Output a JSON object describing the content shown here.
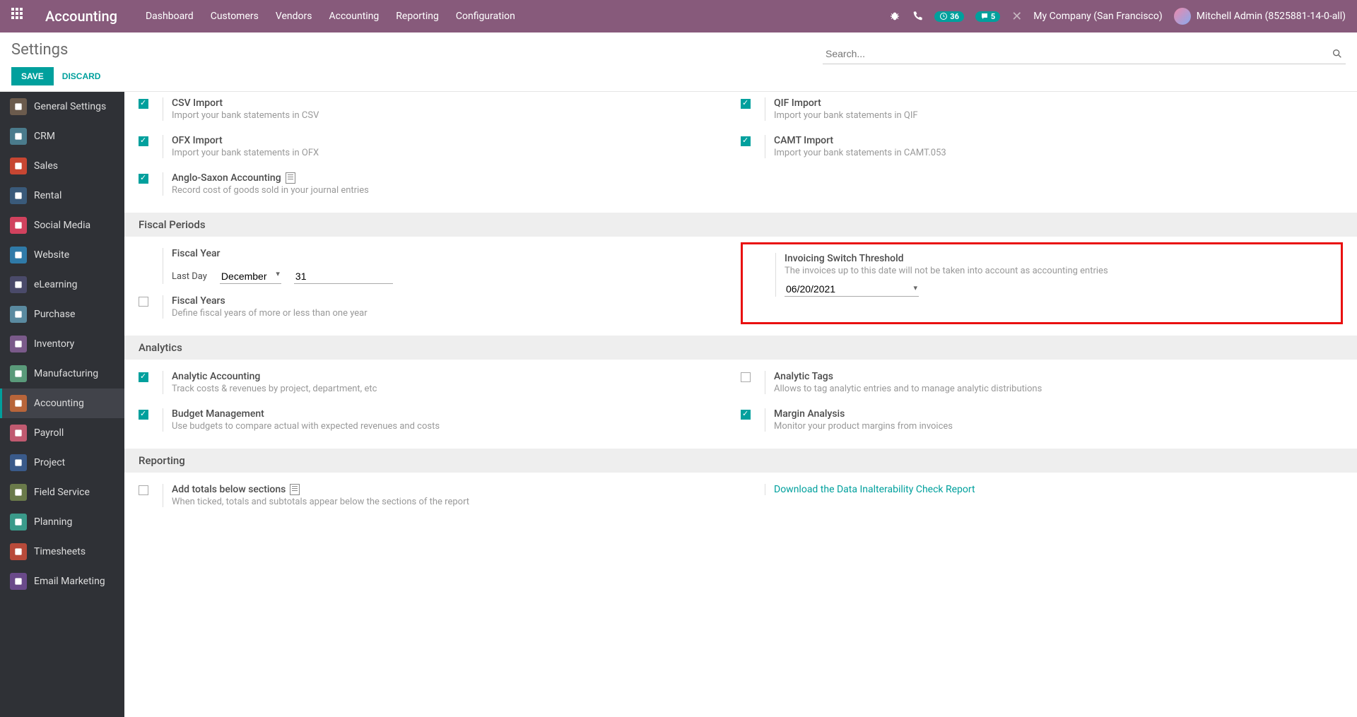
{
  "navbar": {
    "brand": "Accounting",
    "menu": [
      "Dashboard",
      "Customers",
      "Vendors",
      "Accounting",
      "Reporting",
      "Configuration"
    ],
    "badge_clock": "36",
    "badge_chat": "5",
    "company": "My Company (San Francisco)",
    "user": "Mitchell Admin (8525881-14-0-all)"
  },
  "cp": {
    "title": "Settings",
    "save": "SAVE",
    "discard": "DISCARD",
    "search_placeholder": "Search..."
  },
  "sidebar": [
    {
      "label": "General Settings",
      "color": "#6b5b4d"
    },
    {
      "label": "CRM",
      "color": "#4a7b8c"
    },
    {
      "label": "Sales",
      "color": "#c74632"
    },
    {
      "label": "Rental",
      "color": "#3a5a7a"
    },
    {
      "label": "Social Media",
      "color": "#d1425e"
    },
    {
      "label": "Website",
      "color": "#2f7aa8"
    },
    {
      "label": "eLearning",
      "color": "#4a4a6a"
    },
    {
      "label": "Purchase",
      "color": "#5a8aa0"
    },
    {
      "label": "Inventory",
      "color": "#7a5a8a"
    },
    {
      "label": "Manufacturing",
      "color": "#5a9a7a"
    },
    {
      "label": "Accounting",
      "color": "#b8653a",
      "active": true
    },
    {
      "label": "Payroll",
      "color": "#c05a70"
    },
    {
      "label": "Project",
      "color": "#3a5a8a"
    },
    {
      "label": "Field Service",
      "color": "#6a7a4a"
    },
    {
      "label": "Planning",
      "color": "#3a9a8a"
    },
    {
      "label": "Timesheets",
      "color": "#b84a3a"
    },
    {
      "label": "Email Marketing",
      "color": "#6a4a8a"
    }
  ],
  "imports": {
    "csv": {
      "title": "CSV Import",
      "desc": "Import your bank statements in CSV"
    },
    "qif": {
      "title": "QIF Import",
      "desc": "Import your bank statements in QIF"
    },
    "ofx": {
      "title": "OFX Import",
      "desc": "Import your bank statements in OFX"
    },
    "camt": {
      "title": "CAMT Import",
      "desc": "Import your bank statements in CAMT.053"
    },
    "anglo": {
      "title": "Anglo-Saxon Accounting",
      "desc": "Record cost of goods sold in your journal entries"
    }
  },
  "sections": {
    "fiscal": "Fiscal Periods",
    "analytics": "Analytics",
    "reporting": "Reporting"
  },
  "fiscal": {
    "year_title": "Fiscal Year",
    "last_day_label": "Last Day",
    "month": "December",
    "day": "31",
    "years_title": "Fiscal Years",
    "years_desc": "Define fiscal years of more or less than one year",
    "ist_title": "Invoicing Switch Threshold",
    "ist_desc": "The invoices up to this date will not be taken into account as accounting entries",
    "ist_date": "06/20/2021"
  },
  "analytics": {
    "aa": {
      "title": "Analytic Accounting",
      "desc": "Track costs & revenues by project, department, etc"
    },
    "tags": {
      "title": "Analytic Tags",
      "desc": "Allows to tag analytic entries and to manage analytic distributions"
    },
    "budget": {
      "title": "Budget Management",
      "desc": "Use budgets to compare actual with expected revenues and costs"
    },
    "margin": {
      "title": "Margin Analysis",
      "desc": "Monitor your product margins from invoices"
    }
  },
  "reporting": {
    "totals": {
      "title": "Add totals below sections",
      "desc": "When ticked, totals and subtotals appear below the sections of the report"
    },
    "dicr": "Download the Data Inalterability Check Report"
  }
}
